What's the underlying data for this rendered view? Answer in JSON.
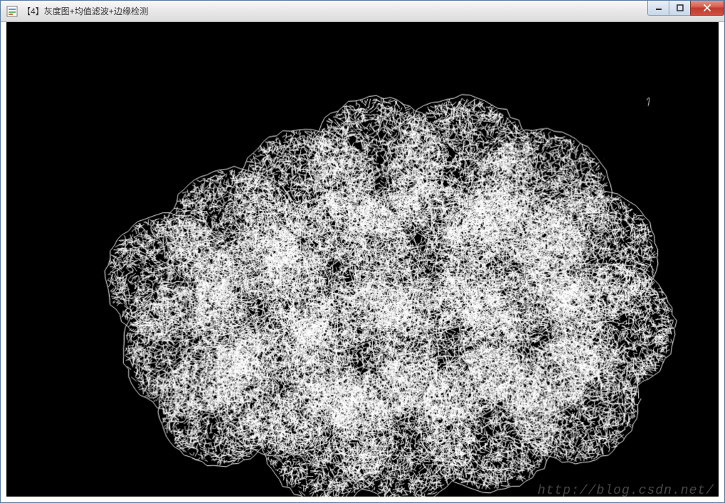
{
  "window": {
    "title": "【4】灰度图+均值滤波+边缘检测",
    "icon_name": "opencv-window-icon"
  },
  "controls": {
    "minimize_label": "Minimize",
    "maximize_label": "Maximize",
    "close_label": "Close"
  },
  "content": {
    "image_description": "Canny/edge-detection output of a cluster of lychee-like textured spheres on black background",
    "background_color": "#000000",
    "edge_color": "#ffffff"
  },
  "watermark": {
    "text": "http://blog.csdn.net/"
  }
}
